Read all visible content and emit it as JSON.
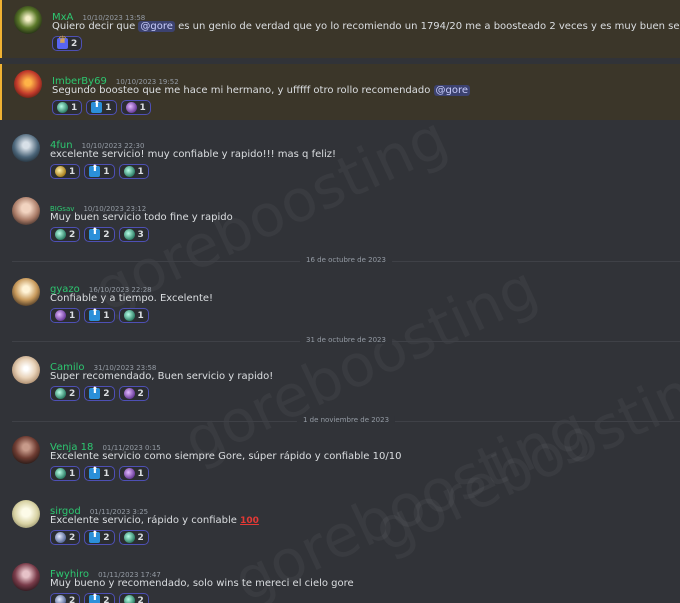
{
  "watermark": "goreboosting",
  "messages": [
    {
      "user": "MxA",
      "time": "10/10/2023 13:58",
      "text_before": "Quiero decir que ",
      "mention": "@gore",
      "text_after": " es un genio de verdad que yo lo recomiendo un 1794/20 me a boosteado 2 veces y es muy buen servicio y si vale la p",
      "reactions": [
        {
          "icon": "crown-emoji",
          "count": "2"
        }
      ]
    },
    {
      "user": "ImberBy69",
      "time": "10/10/2023 19:52",
      "text_before": "Segundo boosteo que me hace mi hermano, y ufffff otro rollo recomendado ",
      "mention": "@gore",
      "text_after": "",
      "reactions": [
        {
          "icon": "rank-teal-emoji",
          "count": "1"
        },
        {
          "icon": "arrow-up-emoji",
          "count": "1"
        },
        {
          "icon": "rank-purple-emoji",
          "count": "1"
        }
      ]
    },
    {
      "user": "4fun",
      "time": "10/10/2023 22:30",
      "text_before": "excelente servicio! muy confiable y rapido!!! mas q feliz!",
      "mention": "",
      "text_after": "",
      "reactions": [
        {
          "icon": "rank-gold-emoji",
          "count": "1"
        },
        {
          "icon": "arrow-up-emoji",
          "count": "1"
        },
        {
          "icon": "rank-teal-emoji",
          "count": "1"
        }
      ]
    },
    {
      "user": "BIGsav",
      "time": "10/10/2023 23:12",
      "text_before": "Muy buen servicio todo fine y rapido",
      "mention": "",
      "text_after": "",
      "reactions": [
        {
          "icon": "rank-teal-emoji",
          "count": "2"
        },
        {
          "icon": "arrow-up-emoji",
          "count": "2"
        },
        {
          "icon": "rank-teal-emoji",
          "count": "3"
        }
      ]
    },
    {
      "user": "gyazo",
      "time": "16/10/2023 22:28",
      "text_before": "Confiable y a tiempo. Excelente!",
      "mention": "",
      "text_after": "",
      "reactions": [
        {
          "icon": "rank-purple-emoji",
          "count": "1"
        },
        {
          "icon": "arrow-up-emoji",
          "count": "1"
        },
        {
          "icon": "rank-teal-emoji",
          "count": "1"
        }
      ]
    },
    {
      "user": "Camilo",
      "time": "31/10/2023 23:58",
      "text_before": "Super recomendado, Buen servicio y rapido!",
      "mention": "",
      "text_after": "",
      "reactions": [
        {
          "icon": "rank-teal-emoji",
          "count": "2"
        },
        {
          "icon": "arrow-up-emoji",
          "count": "2"
        },
        {
          "icon": "rank-purple-emoji",
          "count": "2"
        }
      ]
    },
    {
      "user": "Venja 18",
      "time": "01/11/2023 0:15",
      "text_before": "Excelente servicio como siempre Gore, súper rápido y confiable 10/10",
      "mention": "",
      "text_after": "",
      "reactions": [
        {
          "icon": "rank-teal-emoji",
          "count": "1"
        },
        {
          "icon": "arrow-up-emoji",
          "count": "1"
        },
        {
          "icon": "rank-purple-emoji",
          "count": "1"
        }
      ]
    },
    {
      "user": "sirgod",
      "time": "01/11/2023 3:25",
      "text_before": "Excelente servicio, rápido y confiable ",
      "mention": "",
      "text_after": "",
      "emoji_inline": "100",
      "reactions": [
        {
          "icon": "rank-diamond-emoji",
          "count": "2"
        },
        {
          "icon": "arrow-up-emoji",
          "count": "2"
        },
        {
          "icon": "rank-teal-emoji",
          "count": "2"
        }
      ]
    },
    {
      "user": "Fwyhiro",
      "time": "01/11/2023 17:47",
      "text_before": "Muy bueno y recomendado, solo wins te mereci el cielo gore",
      "mention": "",
      "text_after": "",
      "reactions": [
        {
          "icon": "rank-diamond-emoji",
          "count": "2"
        },
        {
          "icon": "arrow-up-emoji",
          "count": "2"
        },
        {
          "icon": "rank-teal-emoji",
          "count": "2"
        }
      ]
    }
  ],
  "dividers": [
    "16 de octubre de 2023",
    "31 de octubre de 2023",
    "1 de noviembre de 2023"
  ],
  "colors": {
    "background": "#313338",
    "username": "#2dc770",
    "highlight": "#3b3629",
    "mention": "#3c4270",
    "reaction_border": "#4e50b5"
  }
}
